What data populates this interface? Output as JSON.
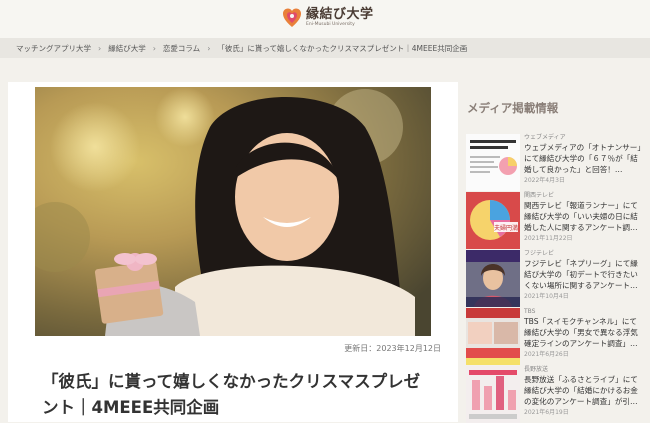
{
  "logo": {
    "title": "縁結び大学",
    "subtitle": "Eni-Musubi University"
  },
  "breadcrumb": [
    "マッチングアプリ大学",
    "縁結び大学",
    "恋愛コラム",
    "「彼氏」に貰って嬉しくなかったクリスマスプレゼント｜4MEEE共同企画"
  ],
  "breadcrumb_sep": "›",
  "article": {
    "updated": "更新日：2023年12月12日",
    "title": "「彼氏」に貰って嬉しくなかったクリスマスプレゼント｜4MEEE共同企画"
  },
  "sidebar": {
    "heading": "メディア掲載情報",
    "items": [
      {
        "source": "ウェブメディア",
        "text": "ウェブメディアの「オトナンサー」にて縁結び大学の「６７％が「結婚して良かった」と回答！…",
        "date": "2022年4月3日"
      },
      {
        "source": "関西テレビ",
        "text": "関西テレビ「報道ランナー」にて縁結び大学の「いい夫婦の日に結婚した人に関するアンケート調…",
        "date": "2021年11月22日",
        "thumb_label": "夫婦円満"
      },
      {
        "source": "フジテレビ",
        "text": "フジテレビ「ネプリーグ」にて縁結び大学の「初デートで行きたいくない場所に関するアンケート…",
        "date": "2021年10月4日"
      },
      {
        "source": "TBS",
        "text": "TBS「スイモクチャンネル」にて縁結び大学の「男女で異なる浮気確定ラインのアンケート調査」…",
        "date": "2021年6月26日"
      },
      {
        "source": "長野放送",
        "text": "長野放送「ふるさとライブ」にて縁結び大学の「結婚にかけるお金の変化のアンケート調査」が引…",
        "date": "2021年6月19日"
      }
    ]
  },
  "colors": {
    "logo_heart_outer": "#e9803a",
    "logo_heart_inner": "#e04b6a",
    "page_bg": "#f3f1ec"
  }
}
